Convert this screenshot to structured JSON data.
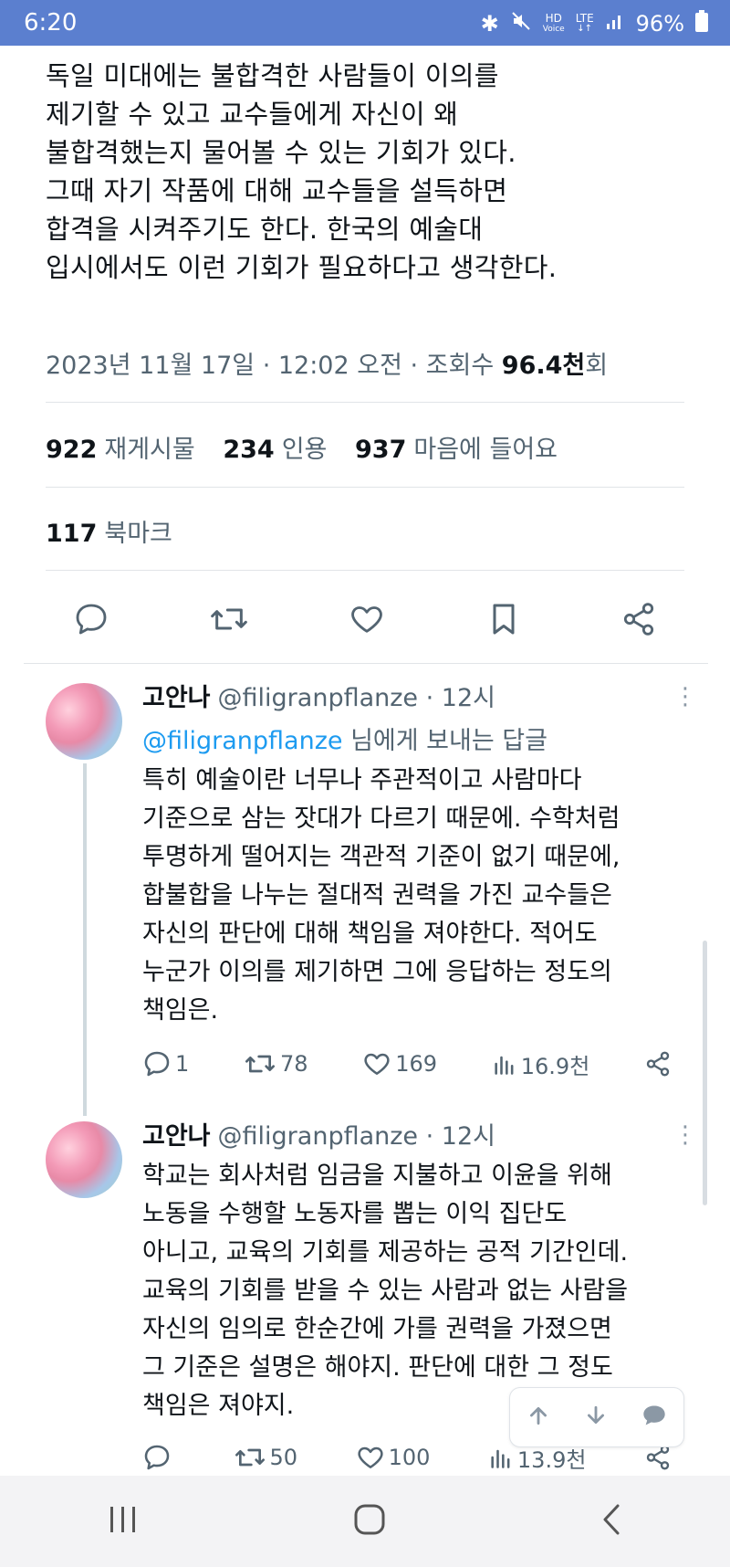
{
  "status_bar": {
    "time": "6:20",
    "hd_label": "HD",
    "voice_label": "Voice",
    "lte_label": "LTE",
    "battery": "96%"
  },
  "tweet": {
    "text_lines": [
      "독일 미대에는 불합격한 사람들이 이의를",
      "제기할 수 있고 교수들에게 자신이 왜",
      "불합격했는지 물어볼 수 있는 기회가 있다.",
      "그때 자기 작품에 대해 교수들을 설득하면",
      "합격을 시켜주기도 한다. 한국의 예술대",
      "입시에서도 이런 기회가 필요하다고 생각한다."
    ],
    "timestamp": "2023년 11월 17일 · 12:02 오전 · 조회수 ",
    "views": "96.4천",
    "views_suffix": "회",
    "retweets_count": "922",
    "retweets_label": "재게시물",
    "quotes_count": "234",
    "quotes_label": "인용",
    "likes_count": "937",
    "likes_label": "마음에 들어요",
    "bookmarks_count": "117",
    "bookmarks_label": "북마크"
  },
  "replies": [
    {
      "name": "고안나",
      "handle_time": "@filigranpflanze · 12시",
      "replying_mention": "@filigranpflanze",
      "replying_suffix": " 님에게 보내는 답글",
      "body_lines": [
        "특히 예술이란 너무나 주관적이고 사람마다",
        "기준으로 삼는 잣대가 다르기 때문에. 수학처럼",
        "투명하게 떨어지는 객관적 기준이 없기 때문에,",
        "합불합을 나누는 절대적 권력을 가진 교수들은",
        "자신의 판단에 대해 책임을 져야한다. 적어도",
        "누군가 이의를 제기하면 그에 응답하는 정도의",
        "책임은."
      ],
      "reply_count": "1",
      "retweet_count": "78",
      "like_count": "169",
      "view_count": "16.9천"
    },
    {
      "name": "고안나",
      "handle_time": "@filigranpflanze · 12시",
      "body_lines": [
        "학교는 회사처럼 임금을 지불하고 이윤을 위해",
        "노동을 수행할 노동자를 뽑는 이익 집단도",
        "아니고, 교육의 기회를 제공하는 공적 기간인데.",
        "교육의 기회를 받을 수 있는 사람과 없는 사람을",
        "자신의 임의로 한순간에 가를 권력을 가졌으면",
        "그 기준은 설명은 해야지. 판단에 대한 그 정도",
        "책임은 져야지."
      ],
      "reply_count": "",
      "retweet_count": "50",
      "like_count": "100",
      "view_count": "13.9천"
    }
  ],
  "more_glyph": "⋮",
  "colors": {
    "status_bar": "#5b7fcf",
    "link": "#1d9bf0",
    "secondary_text": "#536471",
    "icon": "#536471"
  }
}
